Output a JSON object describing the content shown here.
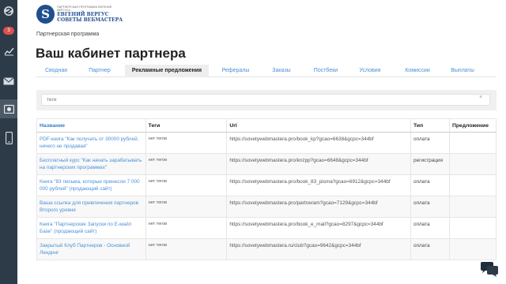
{
  "sidebar": {
    "badge_count": "3",
    "icons": [
      "logo-icon",
      "chart-icon",
      "mail-icon",
      "camera-icon",
      "phone-icon"
    ]
  },
  "logo": {
    "letter": "S",
    "small_text": "ПАРТНЕРСКАЯ ПРОГРАММА ЕВГЕНИЯ ВЕРГУСА",
    "line1": "ЕВГЕНИЙ ВЕРГУС",
    "line2": "СОВЕТЫ ВЕБМАСТЕРА"
  },
  "breadcrumb": "Партнерская программа",
  "page_title": "Ваш кабинет партнера",
  "tabs": [
    {
      "label": "Сводная"
    },
    {
      "label": "Партнер"
    },
    {
      "label": "Рекламные предложения",
      "active": true
    },
    {
      "label": "Рефералы"
    },
    {
      "label": "Заказы"
    },
    {
      "label": "Постбеки"
    },
    {
      "label": "Условия"
    },
    {
      "label": "Комиссии"
    },
    {
      "label": "Выплаты"
    }
  ],
  "filter": {
    "placeholder": "теги",
    "clear_label": "×"
  },
  "table": {
    "headers": [
      "Название",
      "Теги",
      "Url",
      "Тип",
      "Предложение"
    ],
    "rows": [
      {
        "name": "PDF-книга \"Как получать от 30000 рублей, ничего не продавая\"",
        "tags": "нет тегов",
        "url": "https://sovetywebmastera.pro/book_kp?gcao=6638&gcpc=344bf",
        "type": "оплата",
        "offer": ""
      },
      {
        "name": "Бесплатный курс \"Как начать зарабатывать на партнерских программах\"",
        "tags": "нет тегов",
        "url": "https://sovetywebmastera.pro/knzpp?gcao=6648&gcpc=344bf",
        "type": "регистрация",
        "offer": ""
      },
      {
        "name": "Книга \"83 письма, которые принесли 7 000 000 рублей\" (продающий сайт)",
        "tags": "нет тегов",
        "url": "https://sovetywebmastera.pro/book_83_pisma?gcao=6912&gcpc=344bf",
        "type": "оплата",
        "offer": ""
      },
      {
        "name": "Ваша ссылка для привлечения партнеров Второго уровня",
        "tags": "нет тегов",
        "url": "https://sovetywebmastera.pro/partneram?gcao=7129&gcpc=344bf",
        "type": "оплата",
        "offer": ""
      },
      {
        "name": "Книга \"Партнерские Запуски по E-майл Базе\" (продающий сайт)",
        "tags": "нет тегов",
        "url": "https://sovetywebmastera.pro/book_e_mail?gcao=8297&gcpc=344bf",
        "type": "оплата",
        "offer": ""
      },
      {
        "name": "Закрытый Клуб Партнеров - Основной Лендинг",
        "tags": "нет тегов",
        "url": "https://sovetywebmastera.ru/club?gcao=9642&gcpc=344bf",
        "type": "оплата",
        "offer": ""
      }
    ]
  },
  "colors": {
    "sidebar": "#2d3a47",
    "link": "#4a90d9",
    "badge": "#d9534f"
  }
}
